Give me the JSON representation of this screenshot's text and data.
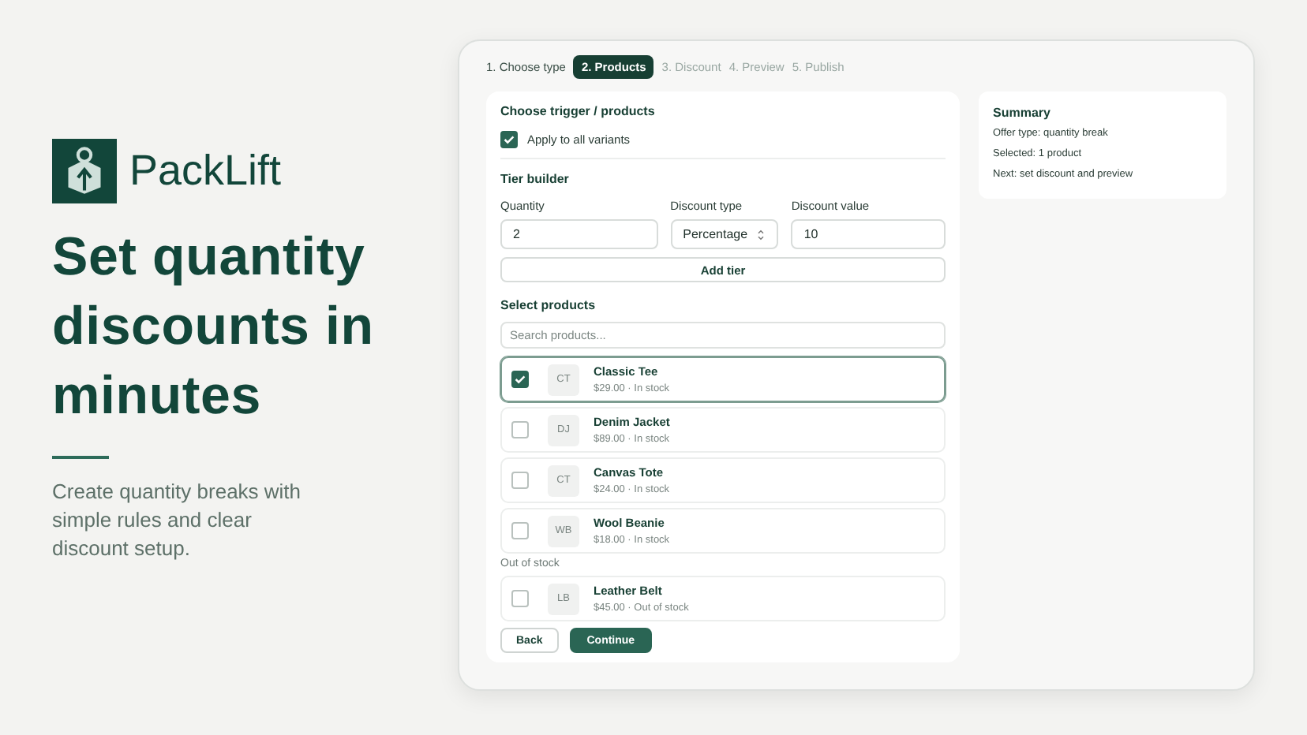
{
  "brand": {
    "name": "PackLift"
  },
  "headline": "Set quantity discounts in minutes",
  "subtext": "Create quantity breaks with simple rules and clear discount setup.",
  "steps": [
    {
      "label": "1. Choose type",
      "completed": true,
      "selected": false
    },
    {
      "label": "2. Products",
      "completed": false,
      "selected": true
    },
    {
      "label": "3. Discount",
      "completed": false,
      "selected": false
    },
    {
      "label": "4. Preview",
      "completed": false,
      "selected": false
    },
    {
      "label": "5. Publish",
      "completed": false,
      "selected": false
    }
  ],
  "trigger": {
    "title": "Choose trigger / products",
    "option": {
      "label": "Apply to all variants",
      "checked": true
    }
  },
  "tier_builder": {
    "title": "Tier builder",
    "fields": [
      {
        "label": "Quantity",
        "value": "2",
        "kind": "text"
      },
      {
        "label": "Discount type",
        "value": "Percentage",
        "kind": "select"
      },
      {
        "label": "Discount value",
        "value": "10",
        "kind": "text"
      }
    ],
    "add_button": "Add tier"
  },
  "products": {
    "title": "Select products",
    "search": {
      "placeholder": "Search products..."
    },
    "groups": [
      {
        "items": [
          {
            "initials": "CT",
            "name": "Classic Tee",
            "meta": "$29.00 · In stock",
            "checked": true
          },
          {
            "initials": "DJ",
            "name": "Denim Jacket",
            "meta": "$89.00 · In stock",
            "checked": false
          },
          {
            "initials": "CT",
            "name": "Canvas Tote",
            "meta": "$24.00 · In stock",
            "checked": false
          },
          {
            "initials": "WB",
            "name": "Wool Beanie",
            "meta": "$18.00 · In stock",
            "checked": false
          }
        ]
      },
      {
        "heading": "Out of stock",
        "items": [
          {
            "initials": "LB",
            "name": "Leather Belt",
            "meta": "$45.00 · Out of stock",
            "checked": false
          }
        ]
      }
    ]
  },
  "actions": [
    {
      "label": "Back",
      "kind": "secondary"
    },
    {
      "label": "Continue",
      "kind": "primary"
    }
  ],
  "summary": {
    "title": "Summary",
    "lines": [
      "Offer type: quantity break",
      "Selected: 1 product",
      "Next: set discount and preview"
    ]
  }
}
